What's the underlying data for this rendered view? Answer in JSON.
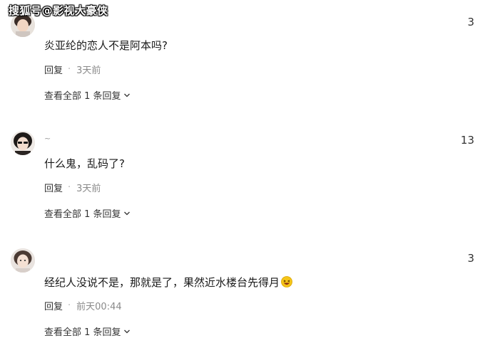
{
  "watermark": "搜狐号@影视大豪侠",
  "comments": [
    {
      "username": "",
      "likes": "3",
      "text": "炎亚纶的恋人不是阿本吗?",
      "reply_label": "回复",
      "separator": "·",
      "time": "3天前",
      "view_all_label": "查看全部 1 条回复"
    },
    {
      "username": "~",
      "likes": "13",
      "text": "什么鬼，乱码了?",
      "reply_label": "回复",
      "separator": "·",
      "time": "3天前",
      "view_all_label": "查看全部 1 条回复"
    },
    {
      "username": "",
      "likes": "3",
      "text": "经纪人没说不是，那就是了，果然近水楼台先得月",
      "reply_label": "回复",
      "separator": "·",
      "time": "前天00:44",
      "view_all_label": "查看全部 1 条回复"
    }
  ],
  "icons": {
    "chevron": "chevron-down-icon",
    "emoji": "laughing-emoji-icon"
  },
  "colors": {
    "text": "#1a1a1a",
    "muted": "#8a8a8a",
    "emoji_face": "#f5c518"
  }
}
